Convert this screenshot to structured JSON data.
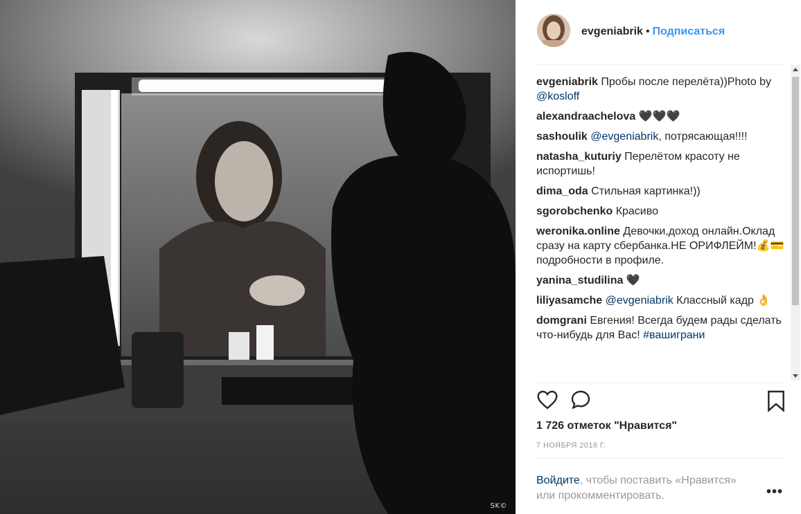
{
  "post": {
    "author": "evgeniabrik",
    "dot": "•",
    "follow_label": "Подписаться",
    "watermark": "SK©"
  },
  "comments": [
    {
      "user": "evgeniabrik",
      "parts": [
        {
          "t": "Пробы после перелёта))Photo by "
        },
        {
          "t": "@kosloff",
          "m": true
        }
      ]
    },
    {
      "user": "alexandraachelova",
      "parts": [
        {
          "t": "🖤🖤🖤"
        }
      ]
    },
    {
      "user": "sashoulik",
      "parts": [
        {
          "t": "@evgeniabrik",
          "m": true
        },
        {
          "t": ", потрясающая!!!!"
        }
      ]
    },
    {
      "user": "natasha_kuturiy",
      "parts": [
        {
          "t": "Перелётом красоту не испортишь!"
        }
      ]
    },
    {
      "user": "dima_oda",
      "parts": [
        {
          "t": "Стильная картинка!))"
        }
      ]
    },
    {
      "user": "sgorobchenko",
      "parts": [
        {
          "t": "Красиво"
        }
      ]
    },
    {
      "user": "weronika.online",
      "parts": [
        {
          "t": "Девочки,доход онлайн.Оклад сразу на карту сбербанка.НЕ ОРИФЛЕЙМ!💰💳 подробности в профиле."
        }
      ]
    },
    {
      "user": "yanina_studilina",
      "parts": [
        {
          "t": "🖤"
        }
      ]
    },
    {
      "user": "liliyasamche",
      "parts": [
        {
          "t": "@evgeniabrik",
          "m": true
        },
        {
          "t": " Классный кадр 👌"
        }
      ]
    },
    {
      "user": "domgrani",
      "parts": [
        {
          "t": "Евгения! Всегда будем рады сделать что-нибудь для Вас! "
        },
        {
          "t": "#вашиграни",
          "m": true
        }
      ]
    }
  ],
  "actions": {
    "like_icon": "heart-icon",
    "comment_icon": "comment-bubble-icon",
    "save_icon": "bookmark-icon"
  },
  "likes_text": "1 726 отметок \"Нравится\"",
  "date_text": "7 НОЯБРЯ 2016 Г.",
  "login": {
    "link": "Войдите",
    "rest": ", чтобы поставить «Нравится» или прокомментировать."
  },
  "more_label": "•••"
}
